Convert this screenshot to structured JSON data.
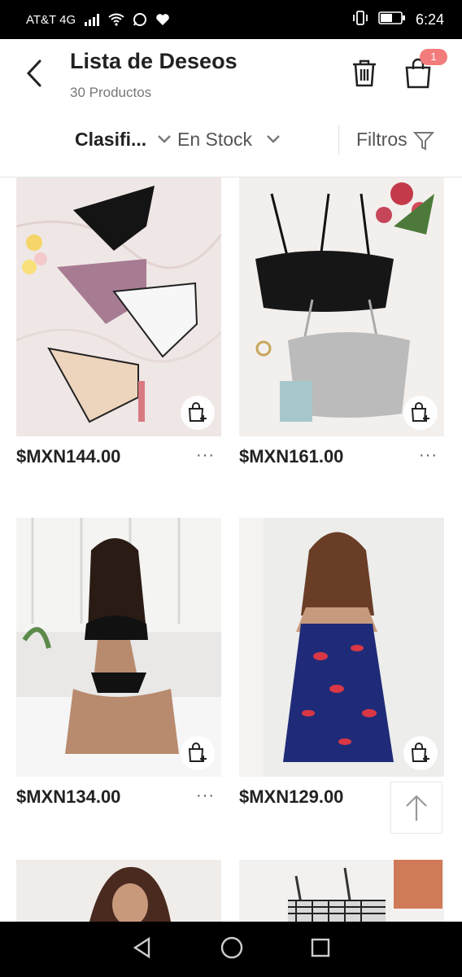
{
  "status_bar": {
    "carrier": "AT&T 4G",
    "time": "6:24"
  },
  "header": {
    "title": "Lista de Deseos",
    "subtitle": "30 Productos",
    "cart_badge": "1"
  },
  "filters": {
    "sort_label": "Clasifi...",
    "stock_label": "En Stock",
    "filters_label": "Filtros"
  },
  "products": [
    {
      "price": "$MXN144.00",
      "more": "···"
    },
    {
      "price": "$MXN161.00",
      "more": "···"
    },
    {
      "price": "$MXN134.00",
      "more": "···"
    },
    {
      "price": "$MXN129.00",
      "more": "···"
    }
  ],
  "colors": {
    "accent_badge": "#f27b7b",
    "text_primary": "#222222",
    "text_secondary": "#777777"
  }
}
